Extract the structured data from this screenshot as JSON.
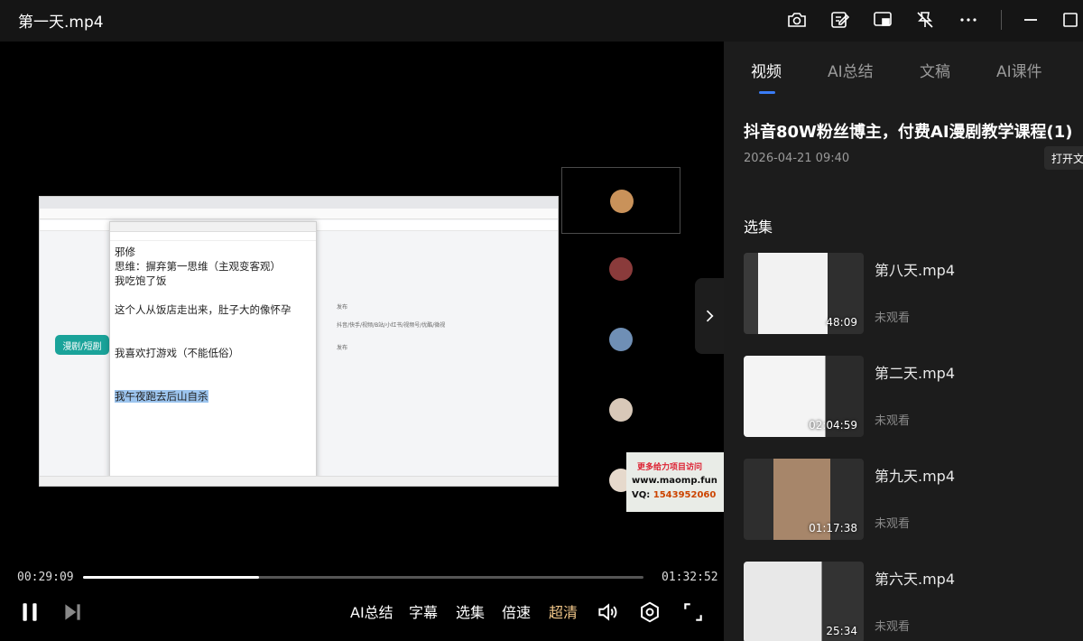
{
  "window": {
    "title": "第一天.mp4"
  },
  "titlebar": {
    "icons": [
      "camera-icon",
      "edit-note-icon",
      "pip-icon",
      "pin-off-icon",
      "more-icon",
      "minimize-icon",
      "maximize-icon"
    ]
  },
  "video": {
    "doc_lines": [
      "邪修",
      "思维：摒弃第一思维（主观变客观）",
      "我吃饱了饭",
      "",
      "这个人从饭店走出来，肚子大的像怀孕",
      "",
      "",
      "我喜欢打游戏（不能低俗）",
      "",
      "",
      "我午夜跑去后山自杀"
    ],
    "mind_node": "漫剧/短剧",
    "branch_1": "发布",
    "branch_2": "抖音/快手/视频/B站/小红书/视频号/优酷/微视",
    "branch_3": "发布",
    "ad_line1": "更多给力项目访问",
    "ad_line2": "www.maomp.fun",
    "ad_line3_label": "VQ:",
    "ad_line3_value": "1543952060"
  },
  "controls": {
    "current_time": "00:29:09",
    "total_time": "01:32:52",
    "progress_fraction": 0.3139,
    "ai_summary": "AI总结",
    "subtitle": "字幕",
    "episodes": "选集",
    "speed": "倍速",
    "quality": "超清"
  },
  "sidebar": {
    "tabs": [
      {
        "label": "视频",
        "active": true
      },
      {
        "label": "AI总结",
        "active": false
      },
      {
        "label": "文稿",
        "active": false
      },
      {
        "label": "AI课件",
        "active": false
      }
    ],
    "course_title": "抖音80W粉丝博主，付费AI漫剧教学课程(1)",
    "date": "2026-04-21 09:40",
    "open_label": "打开文",
    "section_label": "选集",
    "episodes": [
      {
        "title": "第八天.mp4",
        "duration": "48:09",
        "status": "未观看"
      },
      {
        "title": "第二天.mp4",
        "duration": "02:04:59",
        "status": "未观看"
      },
      {
        "title": "第九天.mp4",
        "duration": "01:17:38",
        "status": "未观看"
      },
      {
        "title": "第六天.mp4",
        "duration": "25:34",
        "status": "未观看"
      }
    ]
  },
  "colors": {
    "accent_blue": "#3a7cf6",
    "quality_gold": "#f3c88a",
    "sidebar_bg": "#1c1c1c"
  }
}
